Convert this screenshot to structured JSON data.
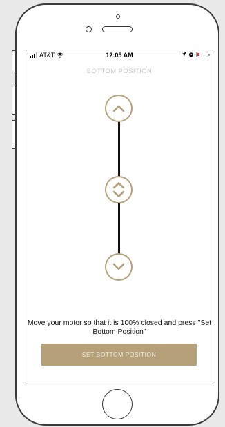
{
  "status_bar": {
    "carrier": "AT&T",
    "time": "12:05 AM"
  },
  "screen": {
    "title": "BOTTOM POSITION",
    "instruction": "Move your motor so that it is 100% closed and press \"Set Bottom Position\"",
    "set_button_label": "SET BOTTOM POSITION"
  },
  "colors": {
    "accent": "#b6a07a",
    "track": "#111111",
    "battery_low": "#e0332f"
  },
  "icons": {
    "up": "chevron-up-icon",
    "stop": "up-down-chevron-icon",
    "down": "chevron-down-icon"
  }
}
